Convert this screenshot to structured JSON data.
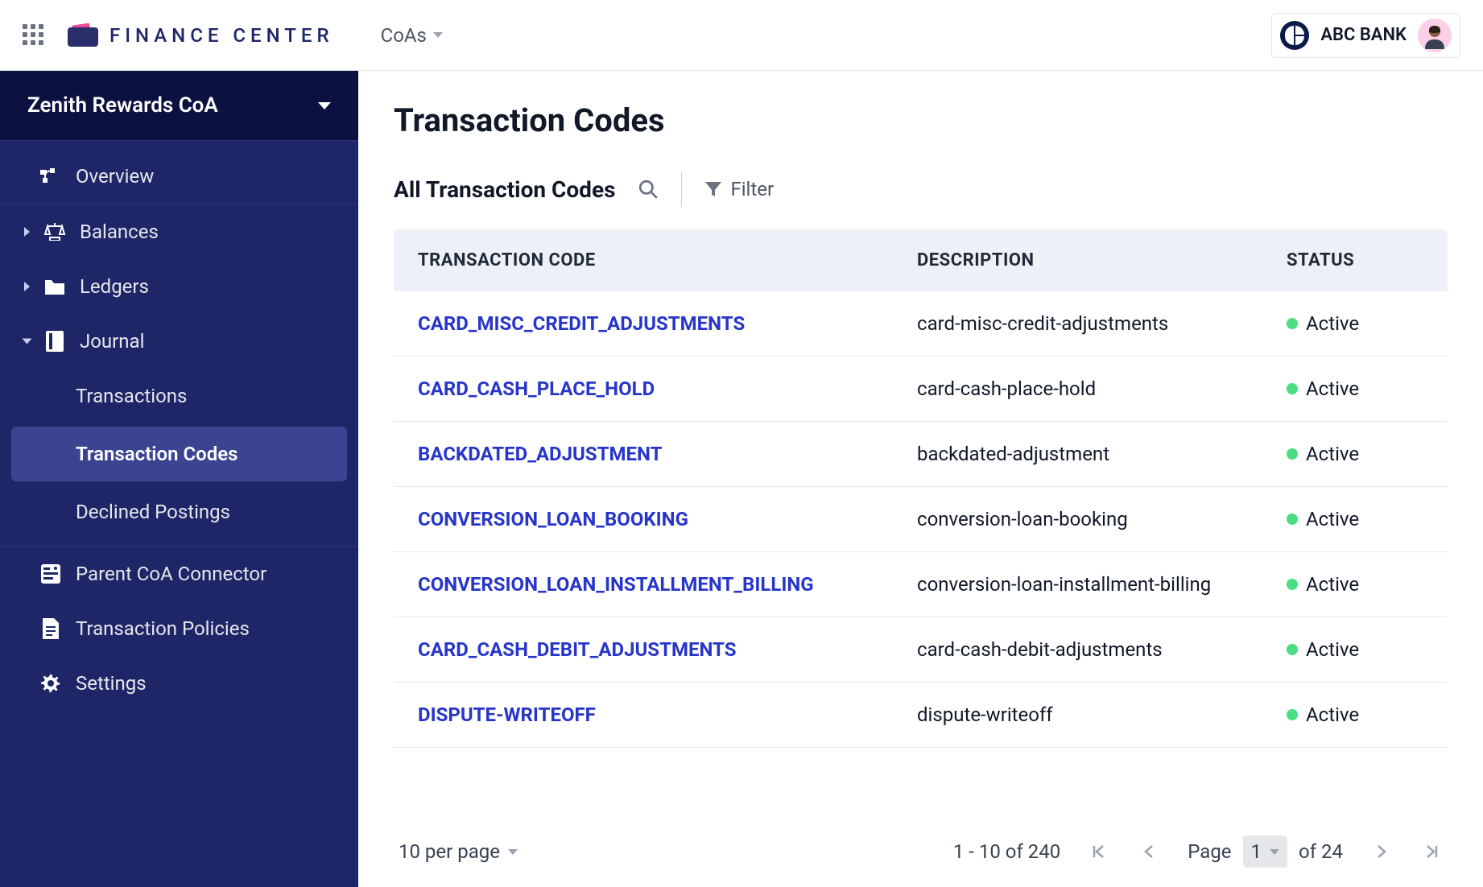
{
  "header": {
    "app_name": "FINANCE CENTER",
    "menu_label": "CoAs",
    "org_name": "ABC BANK"
  },
  "sidebar": {
    "coa_name": "Zenith Rewards CoA",
    "overview": "Overview",
    "balances": "Balances",
    "ledgers": "Ledgers",
    "journal": "Journal",
    "journal_children": {
      "transactions": "Transactions",
      "transaction_codes": "Transaction Codes",
      "declined_postings": "Declined Postings"
    },
    "parent_connector": "Parent CoA Connector",
    "transaction_policies": "Transaction Policies",
    "settings": "Settings"
  },
  "page": {
    "title": "Transaction Codes",
    "subtitle": "All Transaction Codes",
    "filter_label": "Filter"
  },
  "table": {
    "headers": {
      "code": "TRANSACTION CODE",
      "desc": "DESCRIPTION",
      "status": "STATUS"
    },
    "rows": [
      {
        "code": "CARD_MISC_CREDIT_ADJUSTMENTS",
        "desc": "card-misc-credit-adjustments",
        "status": "Active"
      },
      {
        "code": "CARD_CASH_PLACE_HOLD",
        "desc": "card-cash-place-hold",
        "status": "Active"
      },
      {
        "code": "BACKDATED_ADJUSTMENT",
        "desc": "backdated-adjustment",
        "status": "Active"
      },
      {
        "code": "CONVERSION_LOAN_BOOKING",
        "desc": "conversion-loan-booking",
        "status": "Active"
      },
      {
        "code": "CONVERSION_LOAN_INSTALLMENT_BILLING",
        "desc": "conversion-loan-installment-billing",
        "status": "Active"
      },
      {
        "code": "CARD_CASH_DEBIT_ADJUSTMENTS",
        "desc": "card-cash-debit-adjustments",
        "status": "Active"
      },
      {
        "code": "DISPUTE-WRITEOFF",
        "desc": "dispute-writeoff",
        "status": "Active"
      }
    ]
  },
  "pagination": {
    "per_page_label": "10 per page",
    "range_label": "1 - 10 of 240",
    "page_label": "Page",
    "current_page": "1",
    "total_pages_label": "of 24"
  }
}
